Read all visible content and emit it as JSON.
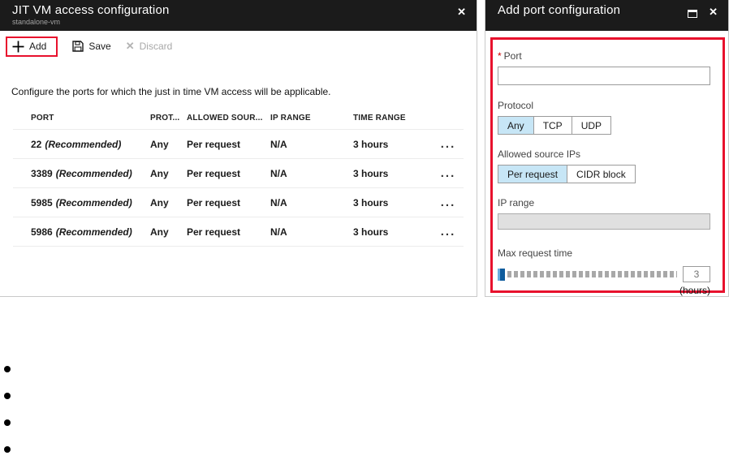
{
  "left_blade": {
    "title": "JIT VM access configuration",
    "subtitle": "standalone-vm",
    "toolbar": {
      "add": "Add",
      "save": "Save",
      "discard": "Discard"
    },
    "description": "Configure the ports for which the just in time VM access will be applicable.",
    "table": {
      "headers": [
        "PORT",
        "PROT...",
        "ALLOWED SOUR...",
        "IP RANGE",
        "TIME RANGE"
      ],
      "rows": [
        {
          "port": "22",
          "recommended": "(Recommended)",
          "protocol": "Any",
          "allowed_source": "Per request",
          "ip_range": "N/A",
          "time_range": "3 hours"
        },
        {
          "port": "3389",
          "recommended": "(Recommended)",
          "protocol": "Any",
          "allowed_source": "Per request",
          "ip_range": "N/A",
          "time_range": "3 hours"
        },
        {
          "port": "5985",
          "recommended": "(Recommended)",
          "protocol": "Any",
          "allowed_source": "Per request",
          "ip_range": "N/A",
          "time_range": "3 hours"
        },
        {
          "port": "5986",
          "recommended": "(Recommended)",
          "protocol": "Any",
          "allowed_source": "Per request",
          "ip_range": "N/A",
          "time_range": "3 hours"
        }
      ]
    }
  },
  "right_blade": {
    "title": "Add port configuration",
    "form": {
      "port": {
        "required": "*",
        "label": "Port",
        "value": "",
        "placeholder": ""
      },
      "protocol": {
        "label": "Protocol",
        "options": [
          "Any",
          "TCP",
          "UDP"
        ],
        "selected": "Any"
      },
      "allowed_source": {
        "label": "Allowed source IPs",
        "options": [
          "Per request",
          "CIDR block"
        ],
        "selected": "Per request"
      },
      "ip_range": {
        "label": "IP range",
        "value": ""
      },
      "max_request_time": {
        "label": "Max request time",
        "value": "3",
        "unit": "(hours)"
      }
    }
  },
  "icons": {
    "close": "✕",
    "ellipsis": "..."
  },
  "colors": {
    "header_bg": "#1b1b1b",
    "annotation_red": "#e8112d",
    "selected_toggle_bg": "#c7e6f6",
    "slider_handle": "#0f5c9d"
  },
  "bullets": {
    "count": 4
  }
}
